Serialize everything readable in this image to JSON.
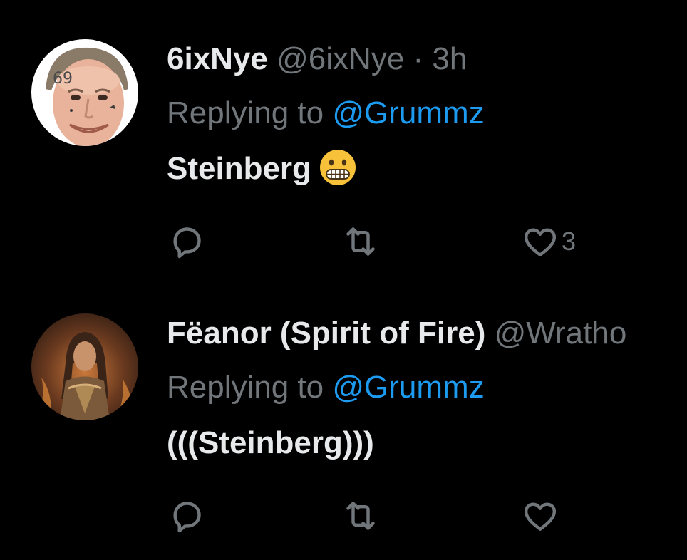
{
  "tweets": [
    {
      "display_name": "6ixNye",
      "handle": "@6ixNye",
      "separator": "·",
      "time": "3h",
      "replying_prefix": "Replying to",
      "replying_to": "@Grummz",
      "text": "Steinberg",
      "emoji": "grimacing-face-emoji",
      "avatar": "bill-nye-69-avatar",
      "like_count": "3"
    },
    {
      "display_name": "Fëanor (Spirit of Fire)",
      "handle": "@Wratho",
      "replying_prefix": "Replying to",
      "replying_to": "@Grummz",
      "text": "(((Steinberg)))",
      "avatar": "feanor-fire-spirit-avatar",
      "like_count": ""
    }
  ],
  "icons": {
    "reply": "reply-icon",
    "retweet": "retweet-icon",
    "like": "heart-icon"
  },
  "colors": {
    "background": "#000000",
    "primary_text": "#e7e9ea",
    "secondary_text": "#71767b",
    "mention": "#1d9bf0",
    "divider": "#2f3336"
  }
}
